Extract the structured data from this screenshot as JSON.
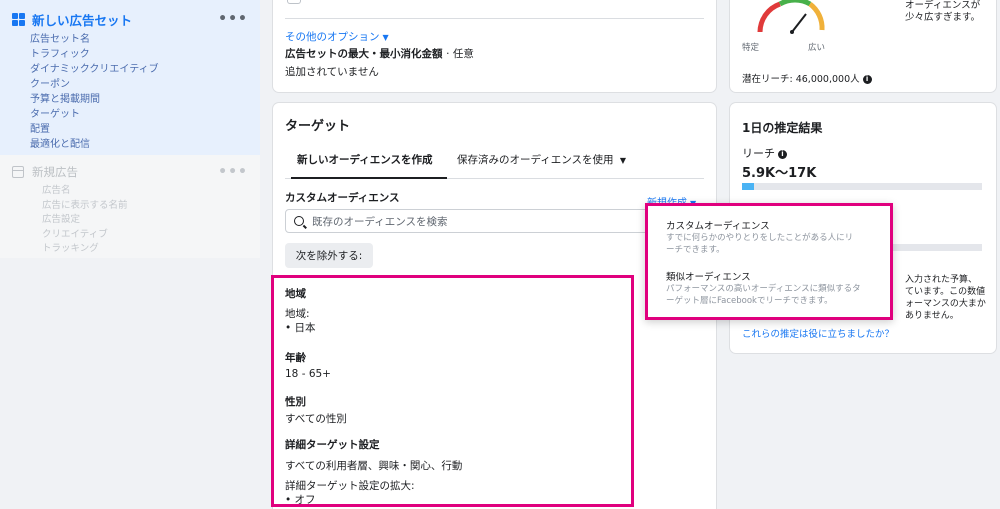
{
  "sidebar": {
    "adset_title": "新しい広告セット",
    "adset_items": [
      "広告セット名",
      "トラフィック",
      "ダイナミッククリエイティブ",
      "クーポン",
      "予算と掲載期間",
      "ターゲット",
      "配置",
      "最適化と配信"
    ],
    "ad_title": "新規広告",
    "ad_items": [
      "広告名",
      "広告に表示する名前",
      "広告設定",
      "クリエイティブ",
      "トラッキング"
    ],
    "more": "•••"
  },
  "options": {
    "other_options": "その他のオプション",
    "budget_label": "広告セットの最大・最小消化金額",
    "budget_optional": "· 任意",
    "budget_value": "追加されていません"
  },
  "target": {
    "title": "ターゲット",
    "tab_new": "新しいオーディエンスを作成",
    "tab_saved": "保存済みのオーディエンスを使用",
    "custom_audience": "カスタムオーディエンス",
    "create_new": "新規作成",
    "search_placeholder": "既存のオーディエンスを検索",
    "exclude_button": "次を除外する:",
    "region_h": "地域",
    "region_label": "地域:",
    "region_value": "• 日本",
    "age_h": "年齢",
    "age_value": "18 - 65+",
    "gender_h": "性別",
    "gender_value": "すべての性別",
    "detail_h": "詳細ターゲット設定",
    "detail_value": "すべての利用者層、興味・関心、行動",
    "detail_expand_label": "詳細ターゲット設定の拡大:",
    "detail_expand_value": "• オフ"
  },
  "dropdown": {
    "items": [
      {
        "title": "カスタムオーディエンス",
        "desc1": "すでに何らかのやりとりをしたことがある人にリ",
        "desc2": "ーチできます。"
      },
      {
        "title": "類似オーディエンス",
        "desc1": "パフォーマンスの高いオーディエンスに類似するタ",
        "desc2": "ーゲット層にFacebookでリーチできます。"
      }
    ]
  },
  "reach": {
    "specific": "特定",
    "broad": "広い",
    "note1": "オーディエンスが",
    "note2": "少々広すぎます。",
    "potential": "潜在リーチ: 46,000,000人"
  },
  "daily": {
    "title": "1日の推定結果",
    "reach_label": "リーチ",
    "reach_value": "5.9K〜17K",
    "note1": "入力された予算、",
    "note2": "ています。この数値",
    "note3": "ォーマンスの大まか",
    "note4": "ありません。",
    "useful_link": "これらの推定は役に立ちましたか？"
  },
  "colors": {
    "accent": "#1877f2",
    "highlight": "#e0007e",
    "reach_bar": "#4ab3f4"
  }
}
